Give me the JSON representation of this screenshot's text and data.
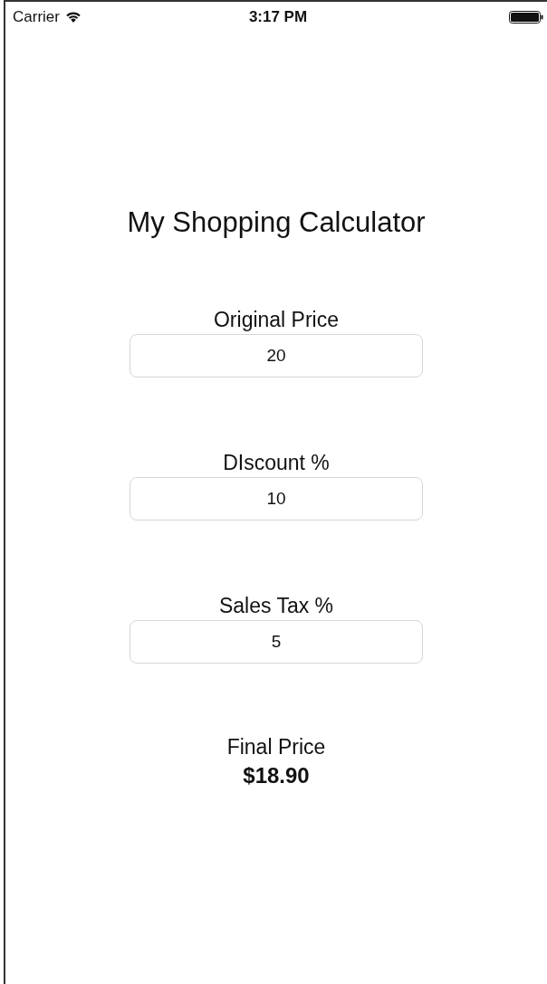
{
  "status_bar": {
    "carrier": "Carrier",
    "time": "3:17 PM"
  },
  "title": "My Shopping Calculator",
  "fields": [
    {
      "label": "Original Price",
      "value": "20"
    },
    {
      "label": "DIscount %",
      "value": "10"
    },
    {
      "label": "Sales Tax %",
      "value": "5"
    }
  ],
  "result": {
    "label": "Final Price",
    "value": "$18.90"
  }
}
